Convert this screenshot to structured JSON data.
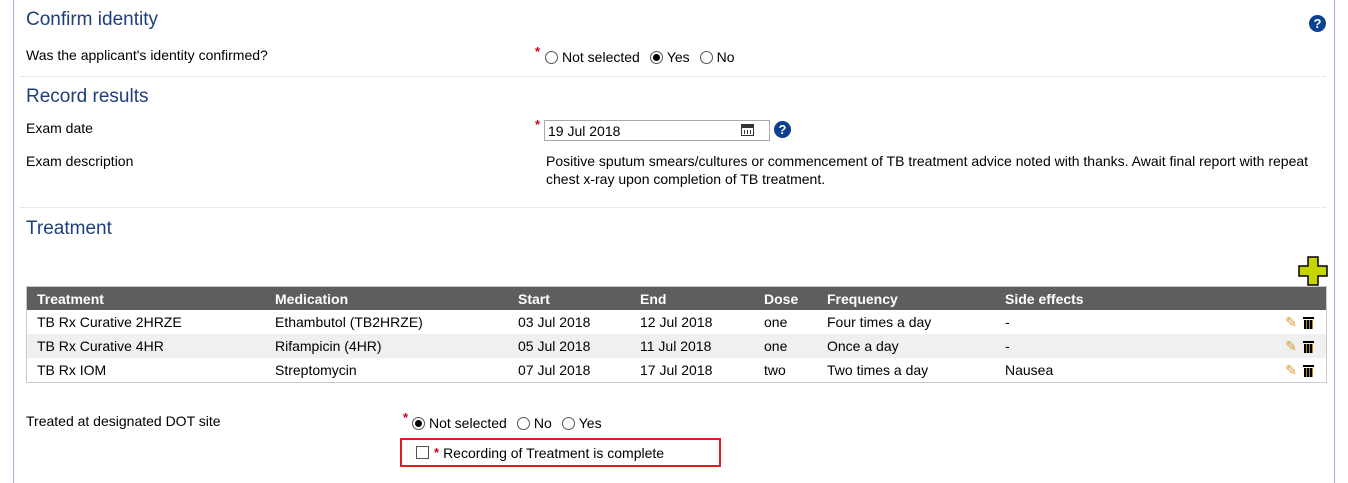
{
  "confirm_identity": {
    "title": "Confirm identity",
    "question": "Was the applicant's identity confirmed?",
    "required_mark": "*",
    "options": [
      {
        "label": "Not selected",
        "checked": false
      },
      {
        "label": "Yes",
        "checked": true
      },
      {
        "label": "No",
        "checked": false
      }
    ],
    "help_icon": "help-icon"
  },
  "record_results": {
    "title": "Record results",
    "exam_date_label": "Exam date",
    "exam_date_value": "19 Jul 2018",
    "exam_description_label": "Exam description",
    "exam_description_text": "Positive sputum smears/cultures or commencement of TB treatment advice noted with thanks. Await final report with repeat chest x-ray upon completion of TB treatment."
  },
  "treatment": {
    "title": "Treatment",
    "add_icon": "add-plus-icon",
    "columns": [
      "Treatment",
      "Medication",
      "Start",
      "End",
      "Dose",
      "Frequency",
      "Side effects"
    ],
    "rows": [
      [
        "TB Rx Curative 2HRZE",
        "Ethambutol (TB2HRZE)",
        "03 Jul 2018",
        "12 Jul 2018",
        "one",
        "Four times a day",
        "-"
      ],
      [
        "TB Rx Curative 4HR",
        "Rifampicin (4HR)",
        "05 Jul 2018",
        "11 Jul 2018",
        "one",
        "Once a day",
        "-"
      ],
      [
        "TB Rx IOM",
        "Streptomycin",
        "07 Jul 2018",
        "17 Jul 2018",
        "two",
        "Two times a day",
        "Nausea"
      ]
    ],
    "dot_site_label": "Treated at designated DOT site",
    "dot_options": [
      {
        "label": "Not selected",
        "checked": true
      },
      {
        "label": "No",
        "checked": false
      },
      {
        "label": "Yes",
        "checked": false
      }
    ],
    "complete_label": "Recording of Treatment is complete",
    "complete_checked": false
  },
  "colors": {
    "section_title": "#1f3f7a",
    "table_header_bg": "#5e5e5e",
    "required": "#d0021b",
    "highlight_border": "#e31b23",
    "add_icon": "#c8d400"
  }
}
